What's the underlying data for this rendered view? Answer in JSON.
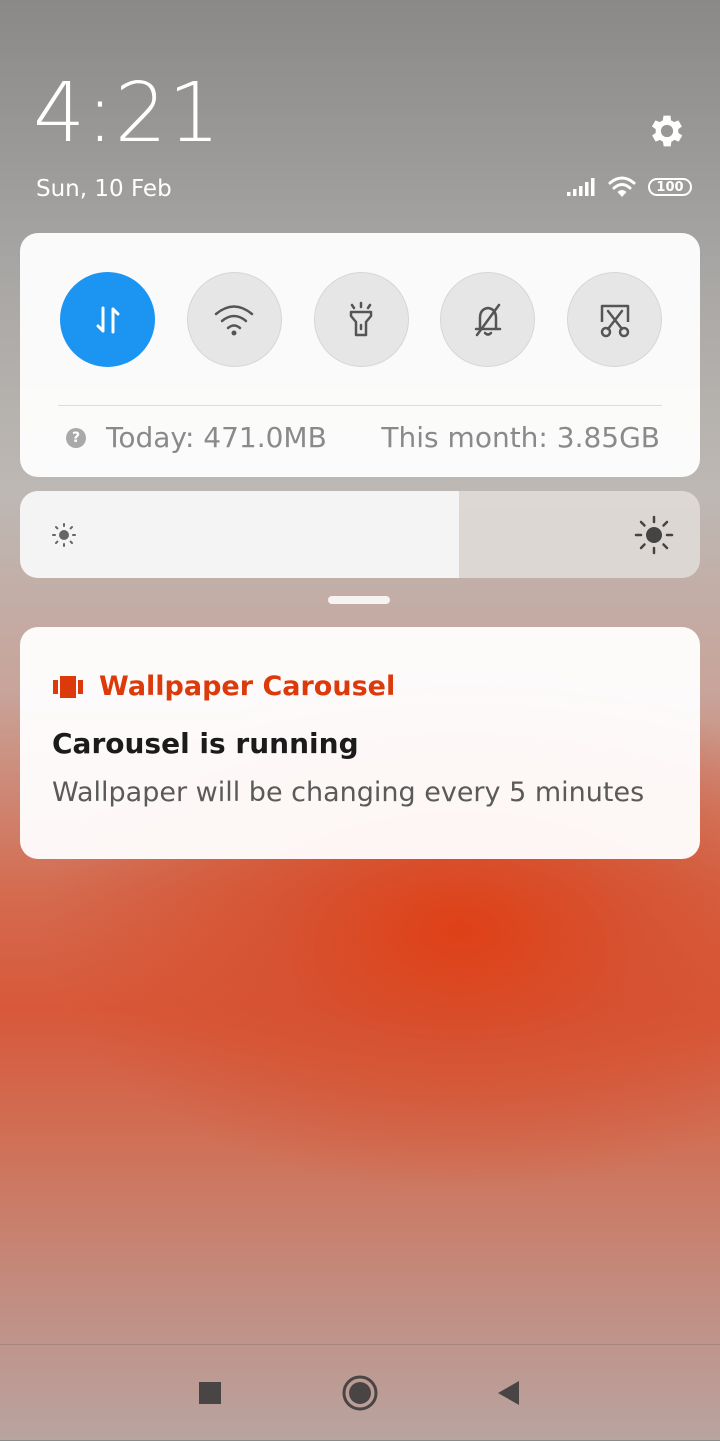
{
  "header": {
    "time": "4:21",
    "date": "Sun, 10 Feb",
    "battery_level": "100"
  },
  "quick_settings": {
    "toggles": [
      {
        "name": "mobile-data",
        "icon": "mobile-data-arrows-icon",
        "active": true
      },
      {
        "name": "wifi",
        "icon": "wifi-icon",
        "active": false
      },
      {
        "name": "flashlight",
        "icon": "flashlight-icon",
        "active": false
      },
      {
        "name": "silent",
        "icon": "bell-off-icon",
        "active": false
      },
      {
        "name": "screenshot",
        "icon": "screenshot-scissors-icon",
        "active": false
      }
    ],
    "data_today": "Today: 471.0MB",
    "data_month": "This month: 3.85GB"
  },
  "brightness": {
    "level_fraction": 0.645
  },
  "notification": {
    "app_name": "Wallpaper Carousel",
    "title": "Carousel is running",
    "text": "Wallpaper will be changing every 5 minutes"
  },
  "colors": {
    "accent_blue": "#1c95f2",
    "app_accent": "#dd3a0c"
  },
  "nav": {
    "buttons": [
      "recents",
      "home",
      "back"
    ]
  }
}
